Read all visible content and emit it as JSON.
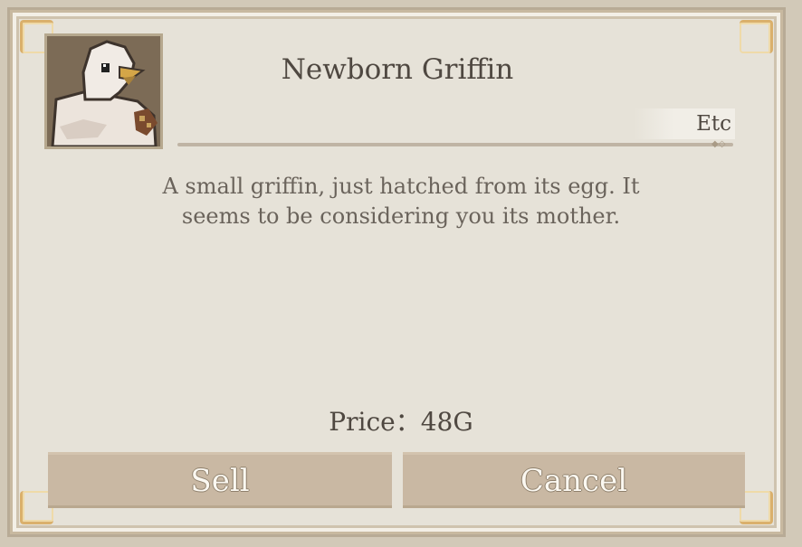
{
  "item": {
    "name": "Newborn Griffin",
    "category": "Etc",
    "description": "A small griffin, just hatched from its egg. It seems to be considering you its mother.",
    "price_label": "Price：48G"
  },
  "buttons": {
    "sell": "Sell",
    "cancel": "Cancel"
  },
  "colors": {
    "panel": "#e6e2d8",
    "button": "#c9b8a3",
    "text": "#4f4841",
    "accent_gold": "#d8a85a"
  },
  "icons": {
    "portrait": "griffin-chick-icon"
  }
}
